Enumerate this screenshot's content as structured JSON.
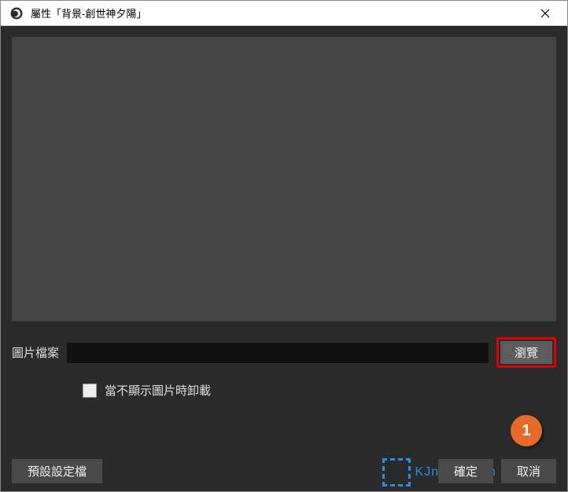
{
  "titlebar": {
    "title": "屬性「背景-創世神夕陽」"
  },
  "form": {
    "file_label": "圖片檔案",
    "file_value": "",
    "browse_label": "瀏覽",
    "checkbox_label": "當不顯示圖片時卸載"
  },
  "footer": {
    "defaults_label": "預設設定檔",
    "ok_label": "確定",
    "cancel_label": "取消"
  },
  "annotation": {
    "number": "1"
  },
  "watermark": {
    "text": "KJnotes.com"
  }
}
